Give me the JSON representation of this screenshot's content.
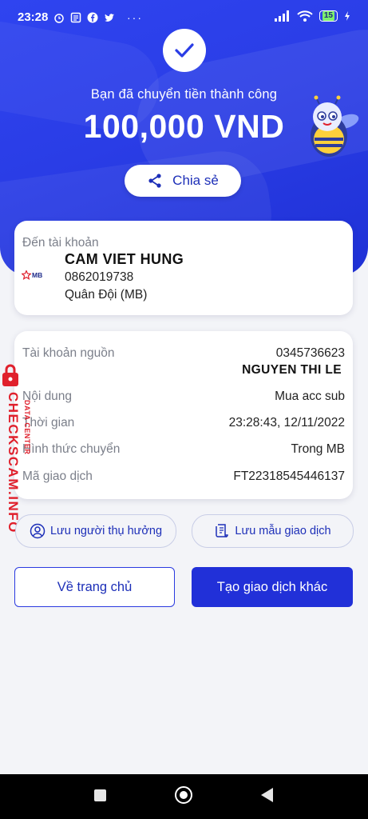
{
  "status_bar": {
    "time": "23:28",
    "battery": "15"
  },
  "hero": {
    "success_text": "Bạn đã chuyển tiền thành công",
    "amount": "100,000 VND",
    "share_label": "Chia sẻ"
  },
  "destination": {
    "label": "Đến tài khoản",
    "bank_logo": "MB",
    "name": "CAM VIET HUNG",
    "account_number": "0862019738",
    "bank_name": "Quân Đội (MB)"
  },
  "details": {
    "source_label": "Tài khoản nguồn",
    "source_account": "0345736623",
    "source_name": "NGUYEN THI LE",
    "content_label": "Nội dung",
    "content_value": "Mua acc sub",
    "time_label": "Thời gian",
    "time_value": "23:28:43, 12/11/2022",
    "method_label": "Hình thức chuyển",
    "method_value": "Trong MB",
    "code_label": "Mã giao dịch",
    "code_value": "FT22318545446137"
  },
  "watermark": {
    "main": "CHECKSCAM.INFO",
    "sub": "DATA CENTER"
  },
  "actions": {
    "save_recipient": "Lưu người thụ hưởng",
    "save_template": "Lưu mẫu giao dịch",
    "home": "Về trang chủ",
    "new_transaction": "Tạo giao dịch khác"
  },
  "colors": {
    "primary": "#2a3de6",
    "accent_red": "#e0202c"
  },
  "icons": [
    "check-icon",
    "share-icon",
    "user-circle-icon",
    "receipt-icon",
    "mascot-bee-icon",
    "lock-icon"
  ]
}
